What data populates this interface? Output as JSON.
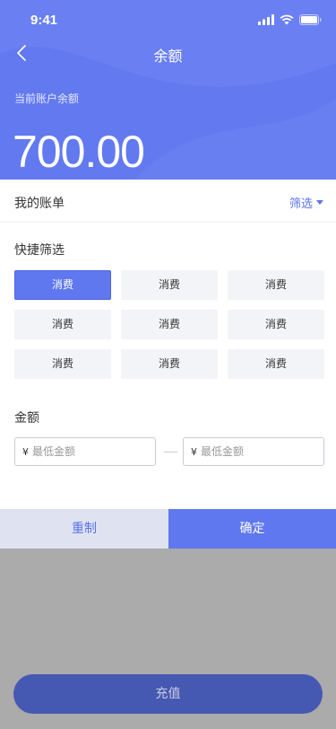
{
  "status_bar": {
    "time": "9:41"
  },
  "nav": {
    "title": "余额"
  },
  "balance": {
    "label": "当前账户余额",
    "amount": "700.00"
  },
  "bill": {
    "title": "我的账单",
    "filter_label": "筛选"
  },
  "quick_filter": {
    "title": "快捷筛选",
    "chips": [
      {
        "label": "消费",
        "active": true
      },
      {
        "label": "消费",
        "active": false
      },
      {
        "label": "消费",
        "active": false
      },
      {
        "label": "消费",
        "active": false
      },
      {
        "label": "消费",
        "active": false
      },
      {
        "label": "消费",
        "active": false
      },
      {
        "label": "消费",
        "active": false
      },
      {
        "label": "消费",
        "active": false
      },
      {
        "label": "消费",
        "active": false
      }
    ]
  },
  "amount": {
    "title": "金额",
    "currency": "¥",
    "min": {
      "placeholder": "最低金额",
      "value": ""
    },
    "max": {
      "placeholder": "最低金额",
      "value": ""
    }
  },
  "actions": {
    "reset_label": "重制",
    "confirm_label": "确定"
  },
  "recharge": {
    "label": "充值"
  },
  "colors": {
    "primary": "#6279f0",
    "accent_text": "#5b73ea",
    "overlay": "#ababab",
    "reset_bg": "#dfe3f1",
    "recharge_bg": "#4659b2"
  },
  "icons": [
    "back-chevron-icon",
    "signal-icon",
    "wifi-icon",
    "battery-icon",
    "caret-down-icon"
  ]
}
